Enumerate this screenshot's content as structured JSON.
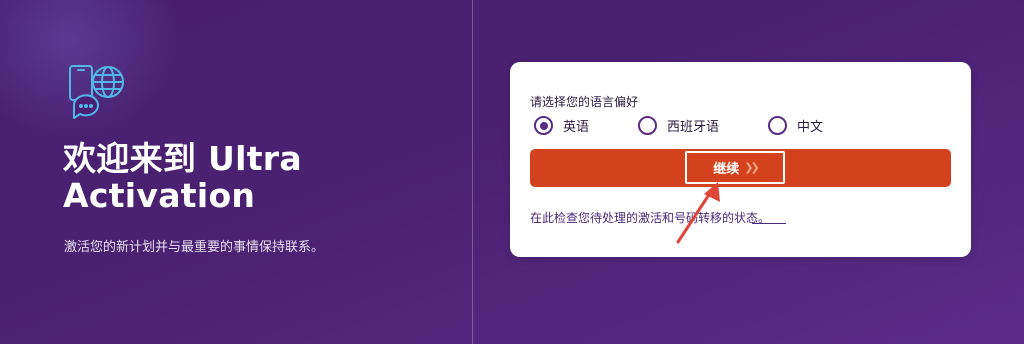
{
  "hero": {
    "icon": "phone-globe-chat-icon",
    "title": "欢迎来到 Ultra Activation",
    "subtitle": "激活您的新计划并与最重要的事情保持联系。"
  },
  "language_card": {
    "label": "请选择您的语言偏好",
    "options": [
      {
        "label": "英语",
        "selected": true
      },
      {
        "label": "西班牙语",
        "selected": false
      },
      {
        "label": "中文",
        "selected": false
      }
    ],
    "continue_label": "继续",
    "continue_icon": "double-chevron-right-icon",
    "status_link": "在此检查您待处理的激活和号码转移的状态。"
  },
  "colors": {
    "background": "#4a1f74",
    "accent": "#d3421c",
    "radio": "#5a2c82",
    "annotation_arrow": "#e0453a"
  },
  "annotation": {
    "icon": "red-pointer-arrow-icon"
  }
}
